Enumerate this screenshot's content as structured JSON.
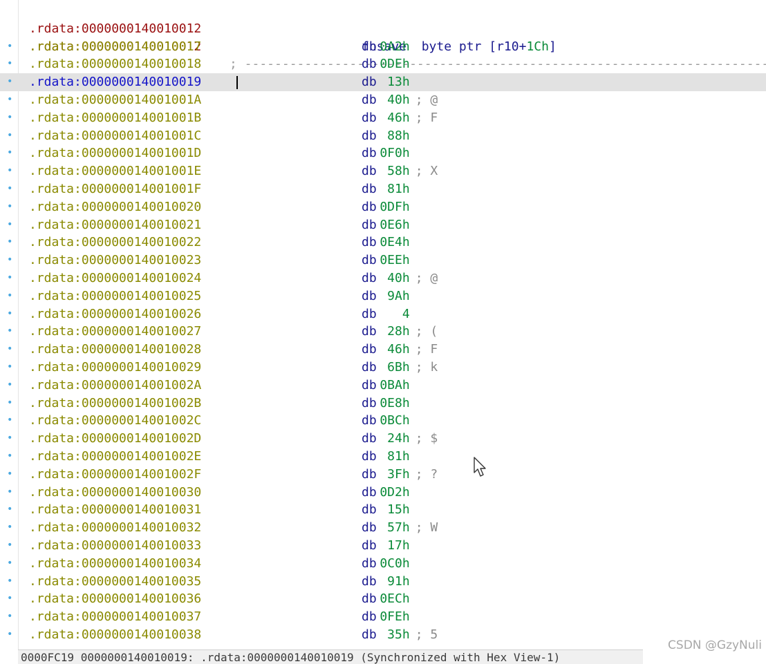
{
  "listing": {
    "header": {
      "address": ".rdata:0000000140010012",
      "mnemonic": "fnsave",
      "operand_pre": "byte ptr [",
      "register": "r10",
      "operand_plus": "+",
      "offset": "1Ch",
      "operand_post": "]"
    },
    "separator": {
      "address": ".rdata:0000000140010012",
      "text": "; -------------------------------------------------------------------------------------"
    },
    "rows": [
      {
        "address": ".rdata:0000000140010017",
        "mnemonic": "db",
        "value": "0A2h",
        "comment": ""
      },
      {
        "address": ".rdata:0000000140010018",
        "mnemonic": "db",
        "value": "0DEh",
        "comment": ""
      },
      {
        "address": ".rdata:0000000140010019",
        "mnemonic": "db",
        "value": "13h",
        "comment": "",
        "selected": true
      },
      {
        "address": ".rdata:000000014001001A",
        "mnemonic": "db",
        "value": "40h",
        "comment": "; @"
      },
      {
        "address": ".rdata:000000014001001B",
        "mnemonic": "db",
        "value": "46h",
        "comment": "; F"
      },
      {
        "address": ".rdata:000000014001001C",
        "mnemonic": "db",
        "value": "88h",
        "comment": ""
      },
      {
        "address": ".rdata:000000014001001D",
        "mnemonic": "db",
        "value": "0F0h",
        "comment": ""
      },
      {
        "address": ".rdata:000000014001001E",
        "mnemonic": "db",
        "value": "58h",
        "comment": "; X"
      },
      {
        "address": ".rdata:000000014001001F",
        "mnemonic": "db",
        "value": "81h",
        "comment": ""
      },
      {
        "address": ".rdata:0000000140010020",
        "mnemonic": "db",
        "value": "0DFh",
        "comment": ""
      },
      {
        "address": ".rdata:0000000140010021",
        "mnemonic": "db",
        "value": "0E6h",
        "comment": ""
      },
      {
        "address": ".rdata:0000000140010022",
        "mnemonic": "db",
        "value": "0E4h",
        "comment": ""
      },
      {
        "address": ".rdata:0000000140010023",
        "mnemonic": "db",
        "value": "0EEh",
        "comment": ""
      },
      {
        "address": ".rdata:0000000140010024",
        "mnemonic": "db",
        "value": "40h",
        "comment": "; @"
      },
      {
        "address": ".rdata:0000000140010025",
        "mnemonic": "db",
        "value": "9Ah",
        "comment": ""
      },
      {
        "address": ".rdata:0000000140010026",
        "mnemonic": "db",
        "value": "4",
        "comment": ""
      },
      {
        "address": ".rdata:0000000140010027",
        "mnemonic": "db",
        "value": "28h",
        "comment": "; ("
      },
      {
        "address": ".rdata:0000000140010028",
        "mnemonic": "db",
        "value": "46h",
        "comment": "; F"
      },
      {
        "address": ".rdata:0000000140010029",
        "mnemonic": "db",
        "value": "6Bh",
        "comment": "; k"
      },
      {
        "address": ".rdata:000000014001002A",
        "mnemonic": "db",
        "value": "0BAh",
        "comment": ""
      },
      {
        "address": ".rdata:000000014001002B",
        "mnemonic": "db",
        "value": "0E8h",
        "comment": ""
      },
      {
        "address": ".rdata:000000014001002C",
        "mnemonic": "db",
        "value": "0BCh",
        "comment": ""
      },
      {
        "address": ".rdata:000000014001002D",
        "mnemonic": "db",
        "value": "24h",
        "comment": "; $"
      },
      {
        "address": ".rdata:000000014001002E",
        "mnemonic": "db",
        "value": "81h",
        "comment": ""
      },
      {
        "address": ".rdata:000000014001002F",
        "mnemonic": "db",
        "value": "3Fh",
        "comment": "; ?"
      },
      {
        "address": ".rdata:0000000140010030",
        "mnemonic": "db",
        "value": "0D2h",
        "comment": ""
      },
      {
        "address": ".rdata:0000000140010031",
        "mnemonic": "db",
        "value": "15h",
        "comment": ""
      },
      {
        "address": ".rdata:0000000140010032",
        "mnemonic": "db",
        "value": "57h",
        "comment": "; W"
      },
      {
        "address": ".rdata:0000000140010033",
        "mnemonic": "db",
        "value": "17h",
        "comment": ""
      },
      {
        "address": ".rdata:0000000140010034",
        "mnemonic": "db",
        "value": "0C0h",
        "comment": ""
      },
      {
        "address": ".rdata:0000000140010035",
        "mnemonic": "db",
        "value": "91h",
        "comment": ""
      },
      {
        "address": ".rdata:0000000140010036",
        "mnemonic": "db",
        "value": "0ECh",
        "comment": ""
      },
      {
        "address": ".rdata:0000000140010037",
        "mnemonic": "db",
        "value": "0FEh",
        "comment": ""
      },
      {
        "address": ".rdata:0000000140010038",
        "mnemonic": "db",
        "value": "35h",
        "comment": "; 5"
      }
    ]
  },
  "status_bar": {
    "text": "0000FC19 0000000140010019: .rdata:0000000140010019 (Synchronized with Hex View-1)"
  },
  "watermark": "CSDN @GzyNuli",
  "colors": {
    "code_address": "#9a1010",
    "data_address": "#8a8a00",
    "selected_address": "#1414c8",
    "mnemonic": "#1a1a8e",
    "number": "#0a8a38",
    "comment": "#8a8a8a",
    "gutter_dot": "#4aa8e0",
    "selection_bg": "#e2e2e2"
  },
  "icons": {
    "gutter_marker": "bullet-dot",
    "mouse_pointer": "arrow-cursor"
  }
}
